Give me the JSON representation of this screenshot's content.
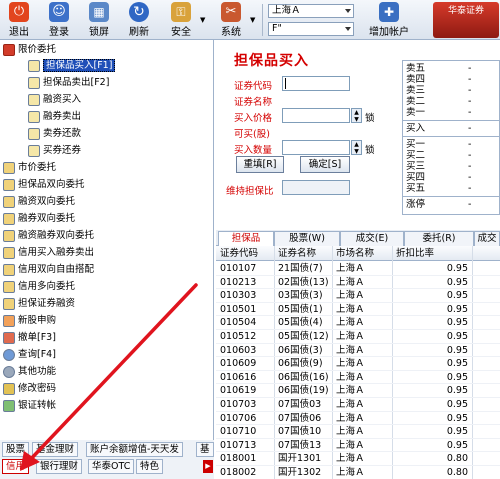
{
  "toolbar": {
    "buttons": [
      {
        "label": "退出",
        "icon": "exit-icon"
      },
      {
        "label": "登录",
        "icon": "users-icon"
      },
      {
        "label": "锁屏",
        "icon": "lock-icon"
      },
      {
        "label": "刷新",
        "icon": "refresh-icon"
      },
      {
        "label": "安全",
        "icon": "security-icon"
      },
      {
        "label": "系统",
        "icon": "tools-icon"
      },
      {
        "label": "增加帐户",
        "icon": "add-account-icon"
      }
    ],
    "market_combo": "上海Ａ",
    "account_combo": "F\"",
    "logo_text": "华泰证券"
  },
  "tree": {
    "group1": "限价委托",
    "items": [
      "担保品买入[F1]",
      "担保品卖出[F2]",
      "融资买入",
      "融券卖出",
      "卖券还款",
      "买券还券"
    ],
    "top": [
      "市价委托",
      "担保品双向委托",
      "融资双向委托",
      "融券双向委托",
      "融资融券双向委托",
      "信用买入融券卖出",
      "信用双向自由搭配",
      "信用多向委托",
      "担保证券融资",
      "新股申购",
      "撤单[F3]",
      "查询[F4]",
      "其他功能",
      "修改密码",
      "银证转帐"
    ]
  },
  "left_tabs": {
    "row1": [
      "股票",
      "基金理财",
      "账户余额增值-天天发",
      "基"
    ],
    "row2": [
      "信用",
      "银行理财",
      "华泰OTC",
      "特色"
    ]
  },
  "form": {
    "title": "担保品买入",
    "code_label": "证券代码",
    "name_label": "证券名称",
    "price_label": "买入价格",
    "avail_label": "可买(股)",
    "qty_label": "买入数量",
    "lock": "锁",
    "reset_label": "重填[R]",
    "confirm_label": "确定[S]",
    "ratio_label": "维持担保比"
  },
  "quote": {
    "sell": [
      "卖五",
      "卖四",
      "卖三",
      "卖二",
      "卖一"
    ],
    "buy_label": "买入",
    "buy": [
      "买一",
      "买二",
      "买三",
      "买四",
      "买五"
    ],
    "limit_label": "涨停",
    "dash": "-"
  },
  "bottom_tabs": [
    "担保品",
    "股票(W)",
    "成交(E)",
    "委托(R)",
    "成交"
  ],
  "grid": {
    "headers": [
      "证券代码",
      "证券名称",
      "市场名称",
      "折扣比率"
    ],
    "rows": [
      [
        "010107",
        "21国债(7)",
        "上海Ａ",
        "0.95"
      ],
      [
        "010213",
        "02国债(13)",
        "上海Ａ",
        "0.95"
      ],
      [
        "010303",
        "03国债(3)",
        "上海Ａ",
        "0.95"
      ],
      [
        "010501",
        "05国债(1)",
        "上海Ａ",
        "0.95"
      ],
      [
        "010504",
        "05国债(4)",
        "上海Ａ",
        "0.95"
      ],
      [
        "010512",
        "05国债(12)",
        "上海Ａ",
        "0.95"
      ],
      [
        "010603",
        "06国债(3)",
        "上海Ａ",
        "0.95"
      ],
      [
        "010609",
        "06国债(9)",
        "上海Ａ",
        "0.95"
      ],
      [
        "010616",
        "06国债(16)",
        "上海Ａ",
        "0.95"
      ],
      [
        "010619",
        "06国债(19)",
        "上海Ａ",
        "0.95"
      ],
      [
        "010703",
        "07国债03",
        "上海Ａ",
        "0.95"
      ],
      [
        "010706",
        "07国债06",
        "上海Ａ",
        "0.95"
      ],
      [
        "010710",
        "07国债10",
        "上海Ａ",
        "0.95"
      ],
      [
        "010713",
        "07国债13",
        "上海Ａ",
        "0.95"
      ],
      [
        "018001",
        "国开1301",
        "上海Ａ",
        "0.80"
      ],
      [
        "018002",
        "国开1302",
        "上海Ａ",
        "0.80"
      ]
    ]
  },
  "colors": {
    "accent": "#d40000",
    "selected": "#1f4fb8",
    "frame": "#9fb2cb"
  }
}
